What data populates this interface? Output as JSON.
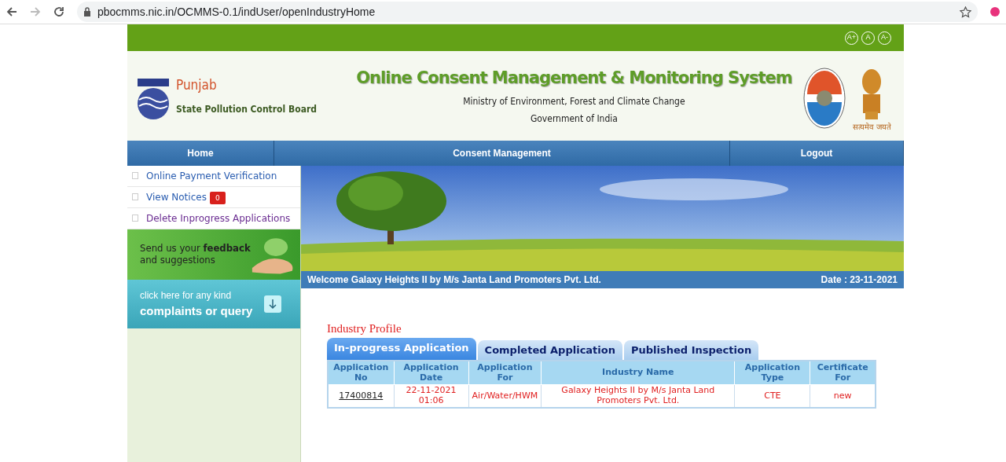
{
  "browser": {
    "url": "pbocmms.nic.in/OCMMS-0.1/indUser/openIndustryHome"
  },
  "header": {
    "font_sizes": [
      "A+",
      "A",
      "A-"
    ],
    "org_name": "Punjab",
    "org_subtitle": "State Pollution Control Board",
    "title": "Online Consent Management & Monitoring System",
    "ministry": "Ministry of Environment, Forest and Climate Change",
    "government": "Government of India",
    "emblem_motto": "सत्यमेव जयते"
  },
  "nav": [
    {
      "label": "Home"
    },
    {
      "label": "Consent Management"
    },
    {
      "label": "Logout"
    }
  ],
  "sidebar": {
    "links": [
      {
        "label": "Online Payment Verification",
        "color": "#2a5db0"
      },
      {
        "label": "View Notices",
        "badge": "0",
        "color": "#2a5db0"
      },
      {
        "label": "Delete Inprogress Applications",
        "color": "#6a2c91"
      }
    ],
    "feedback": "Send us your **feedback** and suggestions",
    "complaints_line1": "click here for any kind",
    "complaints_line2": "complaints or query"
  },
  "welcome": "Welcome Galaxy Heights II by M/s Janta Land Promoters Pvt. Ltd.",
  "date": "Date : 23-11-2021",
  "profile_title": "Industry Profile",
  "tabs": [
    {
      "label": "In-progress Application",
      "selected": true
    },
    {
      "label": "Completed Application",
      "selected": false
    },
    {
      "label": "Published Inspection",
      "selected": false
    }
  ],
  "table": {
    "columns": [
      "Application No",
      "Application Date",
      "Application For",
      "Industry Name",
      "Application Type",
      "Certificate For"
    ],
    "rows": [
      [
        "17400814",
        "22-11-2021 01:06",
        "Air/Water/HWM",
        "Galaxy Heights II by M/s Janta Land Promoters Pvt. Ltd.",
        "CTE",
        "new"
      ]
    ]
  }
}
